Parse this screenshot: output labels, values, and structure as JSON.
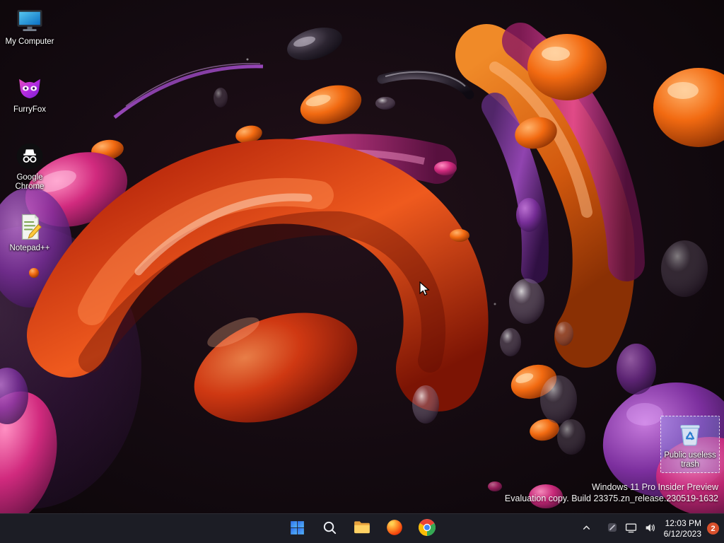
{
  "desktop": {
    "icons": [
      {
        "label": "My Computer"
      },
      {
        "label": "FurryFox"
      },
      {
        "label": "Google Chrome"
      },
      {
        "label": "Notepad++"
      }
    ],
    "recycle_bin": {
      "label": "Public useless trash"
    },
    "watermark": {
      "line1": "Windows 11 Pro Insider Preview",
      "line2": "Evaluation copy. Build 23375.zn_release.230519-1632"
    }
  },
  "taskbar": {
    "buttons": [
      {
        "icon": "start-icon"
      },
      {
        "icon": "search-icon"
      },
      {
        "icon": "file-explorer-icon"
      },
      {
        "icon": "firefox-icon"
      },
      {
        "icon": "chrome-icon"
      }
    ],
    "tray_icons": [
      "chevron-up-icon",
      "tray-app-icon",
      "network-icon",
      "volume-icon"
    ],
    "tray": {
      "time": "12:03 PM",
      "date": "6/12/2023",
      "notification_count": "2"
    }
  },
  "colors": {
    "taskbar_bg": "#1c1d25",
    "badge": "#d9502c",
    "selection_fill": "rgba(130,180,255,0.28)",
    "accent_blue": "#4aa3f5"
  }
}
